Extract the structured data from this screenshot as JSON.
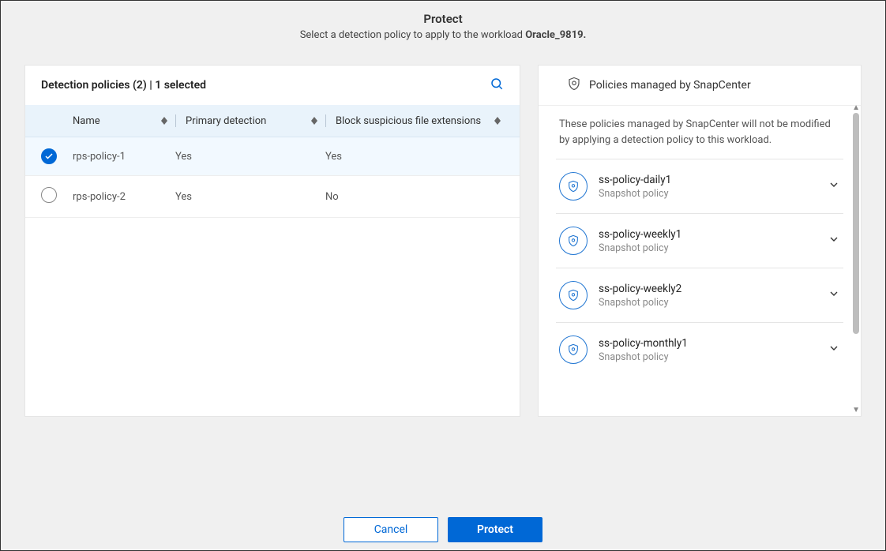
{
  "header": {
    "title": "Protect",
    "subtitle_prefix": "Select a detection policy to apply to the workload ",
    "workload": "Oracle_9819."
  },
  "detection": {
    "title": "Detection policies (2) | 1 selected",
    "columns": {
      "name": "Name",
      "primary": "Primary detection",
      "block": "Block suspicious file extensions"
    },
    "rows": [
      {
        "name": "rps-policy-1",
        "primary": "Yes",
        "block": "Yes",
        "selected": true
      },
      {
        "name": "rps-policy-2",
        "primary": "Yes",
        "block": "No",
        "selected": false
      }
    ]
  },
  "managed": {
    "header": "Policies managed by SnapCenter",
    "desc": "These policies managed by SnapCenter will not be modified by applying a detection policy to this workload.",
    "items": [
      {
        "name": "ss-policy-daily1",
        "sub": "Snapshot policy"
      },
      {
        "name": "ss-policy-weekly1",
        "sub": "Snapshot policy"
      },
      {
        "name": "ss-policy-weekly2",
        "sub": "Snapshot policy"
      },
      {
        "name": "ss-policy-monthly1",
        "sub": "Snapshot policy"
      }
    ]
  },
  "footer": {
    "cancel": "Cancel",
    "protect": "Protect"
  }
}
